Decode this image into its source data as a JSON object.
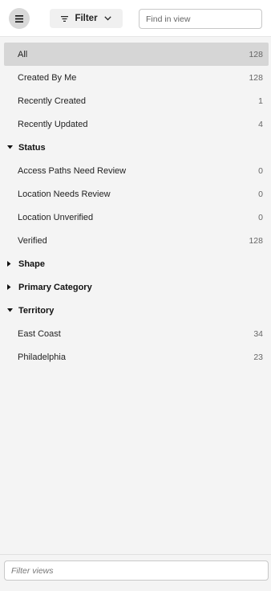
{
  "header": {
    "menu_icon": "hamburger-icon",
    "filter_label": "Filter",
    "filter_icon": "filter-lines-icon",
    "filter_chevron_icon": "chevron-down-icon",
    "find_placeholder": "Find in view"
  },
  "views": {
    "all": {
      "label": "All",
      "count": "128"
    },
    "created_by_me": {
      "label": "Created By Me",
      "count": "128"
    },
    "recently_created": {
      "label": "Recently Created",
      "count": "1"
    },
    "recently_updated": {
      "label": "Recently Updated",
      "count": "4"
    }
  },
  "groups": {
    "status": {
      "label": "Status",
      "expanded": true,
      "items": [
        {
          "label": "Access Paths Need Review",
          "count": "0"
        },
        {
          "label": "Location Needs Review",
          "count": "0"
        },
        {
          "label": "Location Unverified",
          "count": "0"
        },
        {
          "label": "Verified",
          "count": "128"
        }
      ]
    },
    "shape": {
      "label": "Shape",
      "expanded": false
    },
    "primary_category": {
      "label": "Primary Category",
      "expanded": false
    },
    "territory": {
      "label": "Territory",
      "expanded": true,
      "items": [
        {
          "label": "East Coast",
          "count": "34"
        },
        {
          "label": "Philadelphia",
          "count": "23"
        }
      ]
    }
  },
  "footer": {
    "filter_views_placeholder": "Filter views"
  },
  "colors": {
    "selected_row": "#d6d6d6",
    "background": "#f4f4f4",
    "menu_button": "#d9d9d9"
  }
}
